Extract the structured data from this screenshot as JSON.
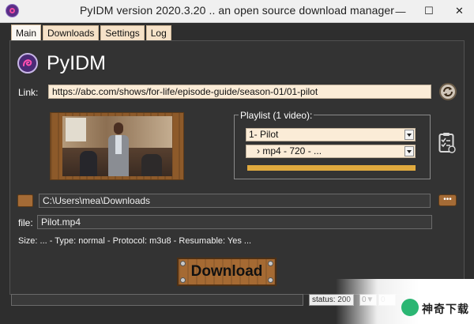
{
  "window": {
    "title": "PyIDM version 2020.3.20 .. an open source download manager",
    "controls": {
      "minimize": "—",
      "maximize": "☐",
      "close": "✕"
    }
  },
  "tabs": [
    {
      "label": "Main",
      "active": true
    },
    {
      "label": "Downloads",
      "active": false
    },
    {
      "label": "Settings",
      "active": false
    },
    {
      "label": "Log",
      "active": false
    }
  ],
  "main": {
    "brand": "PyIDM",
    "link_label": "Link:",
    "link_value": "https://abc.com/shows/for-life/episode-guide/season-01/01-pilot",
    "playlist": {
      "title": "Playlist (1 video):",
      "video_selected": "1- Pilot",
      "stream_selected": "›  mp4 - 720 - ...",
      "progress": 1.0
    },
    "folder_path": "C:\\Users\\mea\\Downloads",
    "more_label": "•••",
    "file_label": "file:",
    "file_value": "Pilot.mp4",
    "info_line": "Size: ... - Type: normal  - Protocol: m3u8 - Resumable: Yes ...",
    "download_button": "Download"
  },
  "statusbar": {
    "status": "status: 200",
    "spin1": "0▼",
    "spin2": "0"
  },
  "watermark": {
    "text": "神奇下载"
  },
  "colors": {
    "background": "#333333",
    "field": "#fbecd7",
    "wood": "#a56a33",
    "progress": "#e0aa3e"
  }
}
